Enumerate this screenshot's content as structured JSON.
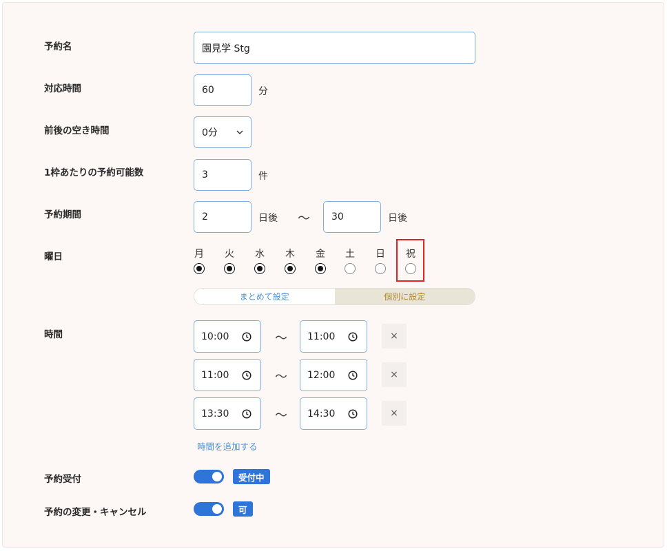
{
  "form": {
    "reservation_name": {
      "label": "予約名",
      "value": "園見学 Stg"
    },
    "duration": {
      "label": "対応時間",
      "value": "60",
      "unit": "分"
    },
    "buffer": {
      "label": "前後の空き時間",
      "value": "0分"
    },
    "capacity": {
      "label": "1枠あたりの予約可能数",
      "value": "3",
      "unit": "件"
    },
    "period": {
      "label": "予約期間",
      "from": "2",
      "from_unit": "日後",
      "separator": "〜",
      "to": "30",
      "to_unit": "日後"
    },
    "weekdays": {
      "label": "曜日",
      "days": [
        {
          "name": "月",
          "checked": true
        },
        {
          "name": "火",
          "checked": true
        },
        {
          "name": "水",
          "checked": true
        },
        {
          "name": "木",
          "checked": true
        },
        {
          "name": "金",
          "checked": true
        },
        {
          "name": "土",
          "checked": false
        },
        {
          "name": "日",
          "checked": false
        },
        {
          "name": "祝",
          "checked": false
        }
      ],
      "mode_bulk": "まとめて設定",
      "mode_individual": "個別に設定"
    },
    "times": {
      "label": "時間",
      "separator": "〜",
      "remove_label": "×",
      "slots": [
        {
          "start": "10:00",
          "end": "11:00"
        },
        {
          "start": "11:00",
          "end": "12:00"
        },
        {
          "start": "13:30",
          "end": "14:30"
        }
      ],
      "add_label": "時間を追加する"
    },
    "accepting": {
      "label": "予約受付",
      "enabled": true,
      "badge": "受付中"
    },
    "changeable": {
      "label": "予約の変更・キャンセル",
      "enabled": true,
      "badge": "可"
    }
  },
  "colors": {
    "accent": "#2f74d9",
    "highlight": "#e02424",
    "border": "#7eaee0"
  }
}
